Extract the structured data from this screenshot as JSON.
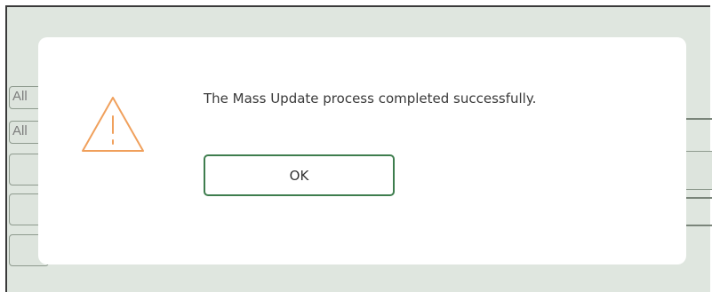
{
  "background": {
    "fields": [
      "All",
      "All",
      "",
      "",
      ""
    ]
  },
  "dialog": {
    "icon": "warning-triangle-icon",
    "icon_color": "#f0a05c",
    "message": "The Mass Update process completed successfully.",
    "ok_label": "OK",
    "ok_border_color": "#3e7d4e"
  }
}
